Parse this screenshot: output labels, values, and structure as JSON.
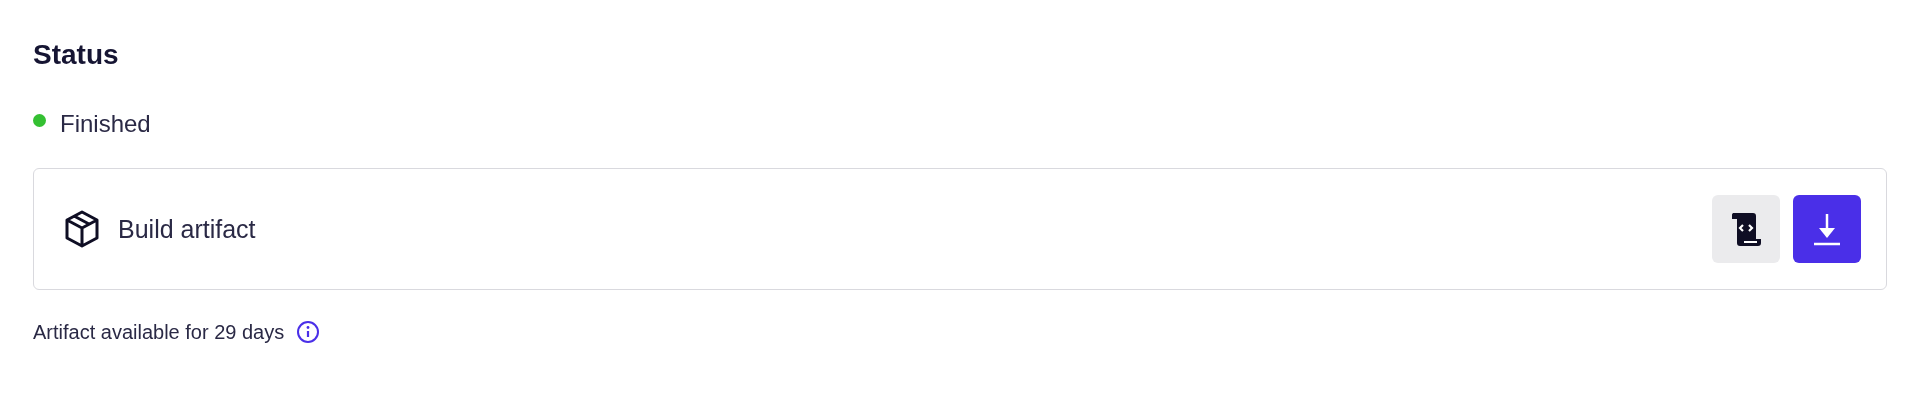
{
  "heading": "Status",
  "status": {
    "label": "Finished",
    "color": "#34c032"
  },
  "artifact": {
    "name": "Build artifact"
  },
  "retention": {
    "text": "Artifact available for 29 days"
  }
}
